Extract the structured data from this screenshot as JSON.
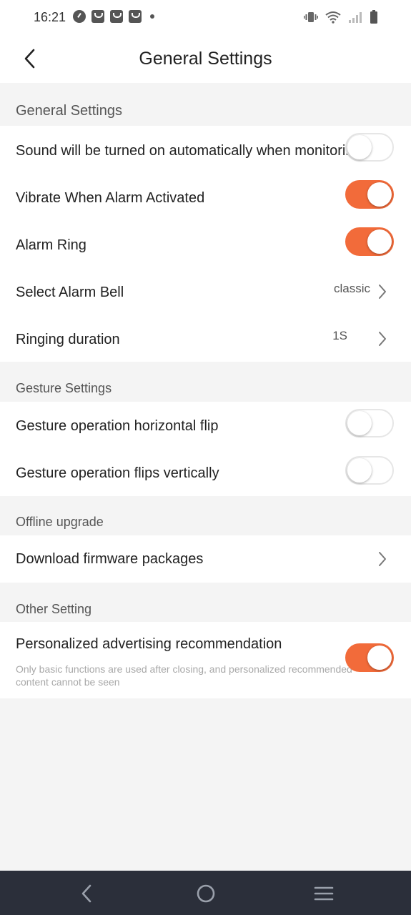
{
  "status": {
    "time": "16:21",
    "notification_icons": [
      "speedometer-icon",
      "bag-icon",
      "bag-icon",
      "bag-icon",
      "dot-icon"
    ],
    "right_icons": [
      "vibrate-icon",
      "wifi-icon",
      "signal-icon",
      "battery-icon"
    ]
  },
  "header": {
    "title": "General Settings",
    "back_icon": "back-arrow-icon"
  },
  "sections": {
    "general": {
      "title": "General Settings",
      "sound_auto": {
        "label": "Sound will be turned on automatically when monitoring",
        "enabled": false
      },
      "vibrate": {
        "label": "Vibrate When Alarm Activated",
        "enabled": true
      },
      "alarm_ring": {
        "label": "Alarm Ring",
        "enabled": true
      },
      "alarm_bell": {
        "label": "Select Alarm Bell",
        "value": "classic"
      },
      "ringing_duration": {
        "label": "Ringing duration",
        "value": "1S"
      }
    },
    "gesture": {
      "title": "Gesture Settings",
      "horizontal_flip": {
        "label": "Gesture operation horizontal flip",
        "enabled": false
      },
      "vertical_flip": {
        "label": "Gesture operation flips vertically",
        "enabled": false
      }
    },
    "offline": {
      "title": "Offline upgrade",
      "download": {
        "label": "Download firmware packages"
      }
    },
    "other": {
      "title": "Other Setting",
      "ads": {
        "label": "Personalized advertising recommendation",
        "description": "Only basic functions are used after closing, and personalized recommended content cannot be seen",
        "enabled": true
      }
    }
  },
  "colors": {
    "accent": "#f26b3a",
    "background": "#f4f4f4",
    "card": "#ffffff",
    "bottom_nav": "#2b2f3a"
  },
  "bottom_nav": {
    "icons": [
      "back-nav-icon",
      "home-nav-icon",
      "recents-nav-icon"
    ]
  }
}
